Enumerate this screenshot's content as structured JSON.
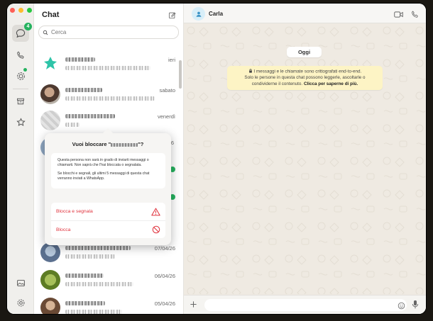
{
  "app": {
    "title": "Chat",
    "unread_badge": "4"
  },
  "search": {
    "placeholder": "Cerca"
  },
  "chats": [
    {
      "date": "ieri",
      "avatar_color": "#2ec4a8"
    },
    {
      "date": "sabato",
      "avatar_color": "#6b5548"
    },
    {
      "date": "venerdì",
      "avatar_color": "#d8d8d8"
    },
    {
      "date": "07/04/26",
      "avatar_color": "#6a7f9b"
    },
    {
      "date": "06/04/26",
      "avatar_color": "#7aa03a"
    },
    {
      "date": "05/04/26",
      "avatar_color": "#8a6a50"
    }
  ],
  "block_popover": {
    "title_prefix": "Vuoi bloccare \"",
    "title_suffix": "\"?",
    "body_1": "Questa persona non sarà in grado di inviarti messaggi o chiamarti. Non saprà che l'hai bloccata o segnalata.",
    "body_2": "Se blocchi e segnali, gli ultimi 5 messaggi di questa chat verranno inviati a WhatsApp.",
    "action_report": "Blocca e segnala",
    "action_block": "Blocca",
    "action_color": "#e0323c"
  },
  "conversation": {
    "contact_name": "Carla",
    "day_label": "Oggi",
    "encryption_notice_1": "I messaggi e le chiamate sono crittografati end-to-end.",
    "encryption_notice_2": "Solo le persone in questa chat possono leggerle, ascoltarle o condividerne il contenuto.",
    "encryption_link": "Clicca per saperne di più."
  },
  "colors": {
    "accent_green": "#25b25f",
    "wallpaper": "#efeae2",
    "notice_bg": "#fdf4c5"
  }
}
